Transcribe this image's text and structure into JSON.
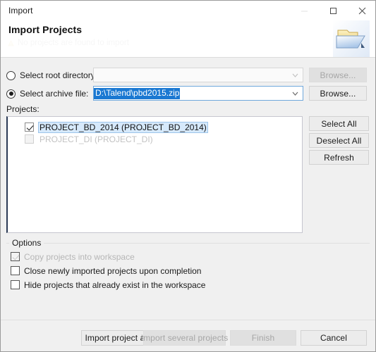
{
  "window": {
    "title": "Import",
    "controls": {
      "minimize": "minimize-icon",
      "maximize": "maximize-icon",
      "close": "close-icon"
    }
  },
  "header": {
    "title": "Import Projects",
    "message": "No projects are found to import",
    "icon": "import-folder-icon"
  },
  "source": {
    "root_directory": {
      "label": "Select root directory:",
      "selected": false,
      "value": "",
      "browse_label": "Browse...",
      "browse_enabled": false
    },
    "archive_file": {
      "label": "Select archive file:",
      "selected": true,
      "value": "D:\\Talend\\pbd2015.zip",
      "browse_label": "Browse...",
      "browse_enabled": true
    }
  },
  "projects": {
    "label": "Projects:",
    "items": [
      {
        "label": "PROJECT_BD_2014 (PROJECT_BD_2014)",
        "checked": true,
        "enabled": true,
        "selected": true
      },
      {
        "label": "PROJECT_DI (PROJECT_DI)",
        "checked": false,
        "enabled": false,
        "selected": false
      }
    ],
    "buttons": [
      {
        "label": "Select All"
      },
      {
        "label": "Deselect All"
      },
      {
        "label": "Refresh"
      }
    ]
  },
  "options": {
    "title": "Options",
    "items": [
      {
        "label": "Copy projects into workspace",
        "checked": true,
        "enabled": false
      },
      {
        "label": "Close newly imported projects upon completion",
        "checked": false,
        "enabled": true
      },
      {
        "label": "Hide projects that already exist in the workspace",
        "checked": false,
        "enabled": true
      }
    ]
  },
  "footer": {
    "buttons": [
      {
        "label": "Import project as",
        "enabled": true
      },
      {
        "label": "Import several projects",
        "enabled": false
      },
      {
        "label": "Finish",
        "enabled": false
      },
      {
        "label": "Cancel",
        "enabled": true
      }
    ]
  },
  "colors": {
    "selection_blue": "#1a78d2",
    "list_selection": "#d6e9fb",
    "dialog_bg": "#f0f0f0"
  }
}
